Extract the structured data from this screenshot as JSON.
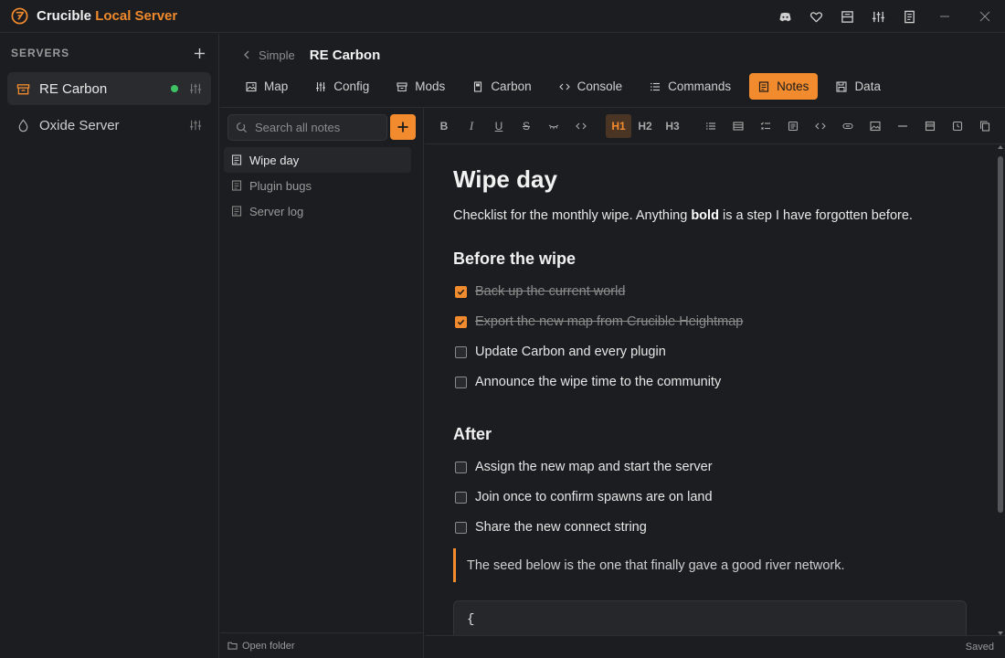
{
  "app": {
    "title_part1": "Crucible",
    "title_part2": "Local Server",
    "accent_color": "#f28b2e",
    "titlebar_icons": [
      "discord-icon",
      "heart-icon",
      "layout-icon",
      "sliders-icon",
      "document-icon"
    ]
  },
  "sidebar": {
    "title": "SERVERS",
    "servers": [
      {
        "name": "RE Carbon",
        "icon": "server-icon",
        "status": "online",
        "status_color": "#3ec264"
      },
      {
        "name": "Oxide Server",
        "icon": "droplet-icon"
      }
    ]
  },
  "header": {
    "breadcrumb_back": "Simple",
    "breadcrumb_current": "RE Carbon",
    "tabs": [
      {
        "label": "Map",
        "icon": "image-icon"
      },
      {
        "label": "Config",
        "icon": "sliders-icon"
      },
      {
        "label": "Mods",
        "icon": "archive-icon"
      },
      {
        "label": "Carbon",
        "icon": "file-icon"
      },
      {
        "label": "Console",
        "icon": "code-icon"
      },
      {
        "label": "Commands",
        "icon": "list-icon"
      },
      {
        "label": "Notes",
        "icon": "note-icon",
        "active": true
      },
      {
        "label": "Data",
        "icon": "save-icon"
      }
    ]
  },
  "notes": {
    "search_placeholder": "Search all notes",
    "items": [
      {
        "label": "Wipe day",
        "active": true
      },
      {
        "label": "Plugin bugs"
      },
      {
        "label": "Server log"
      }
    ],
    "footer": "Open folder"
  },
  "toolbar": {
    "h1": "H1",
    "h2": "H2",
    "h3": "H3",
    "bold": "B",
    "italic": "I",
    "underline": "U",
    "strike": "S"
  },
  "document": {
    "title": "Wipe day",
    "intro_before": "Checklist for the monthly wipe. Anything ",
    "intro_bold": "bold",
    "intro_after": " is a step I have forgotten before.",
    "section1": "Before the wipe",
    "tasks1": [
      {
        "text": "Back up the current world",
        "checked": true
      },
      {
        "text": "Export the new map from Crucible Heightmap",
        "checked": true
      },
      {
        "text": "Update Carbon and every plugin",
        "checked": false
      },
      {
        "text": "Announce the wipe time to the community",
        "checked": false
      }
    ],
    "section2": "After",
    "tasks2": [
      {
        "text": "Assign the new map and start the server",
        "checked": false
      },
      {
        "text": "Join once to confirm spawns are on land",
        "checked": false
      },
      {
        "text": "Share the new connect string",
        "checked": false
      }
    ],
    "quote": "The seed below is the one that finally gave a good river network.",
    "code_first_line": "{"
  },
  "status": {
    "save_state": "Saved"
  }
}
